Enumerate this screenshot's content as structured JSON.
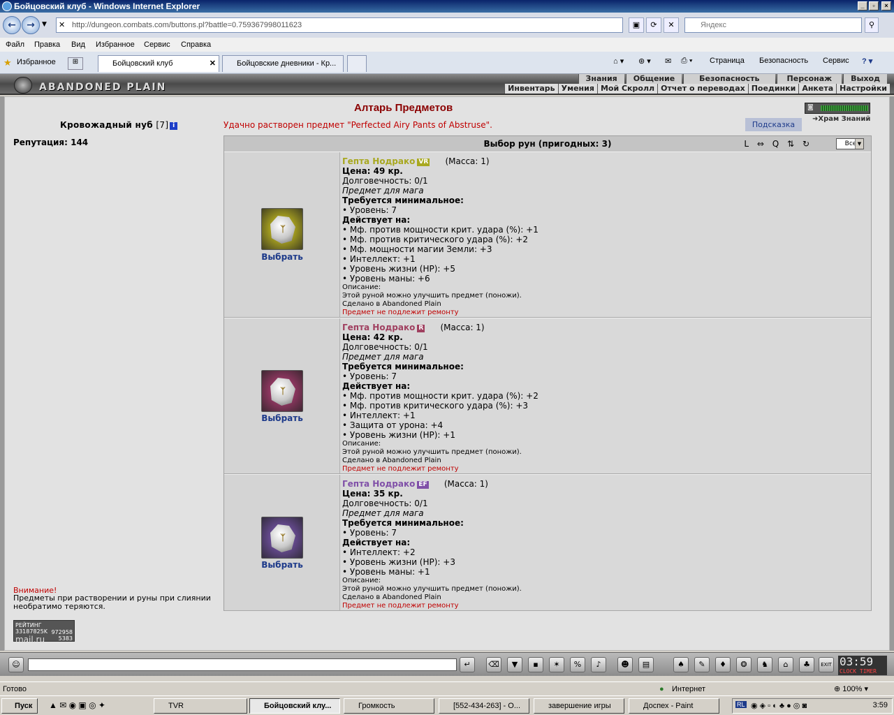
{
  "window": {
    "title": "Бойцовский клуб - Windows Internet Explorer"
  },
  "browser": {
    "url": "http://dungeon.combats.com/buttons.pl?battle=0.759367998011623",
    "search_placeholder": "Яндекс",
    "menu": [
      "Файл",
      "Правка",
      "Вид",
      "Избранное",
      "Сервис",
      "Справка"
    ],
    "favorites_label": "Избранное",
    "tabs": [
      "Бойцовский клуб",
      "Бойцовские дневники - Кр..."
    ],
    "commands": [
      "Страница",
      "Безопасность",
      "Сервис"
    ],
    "status_text": "Готово",
    "zone": "Интернет",
    "zoom": "100%"
  },
  "game": {
    "logo": "ABANDONED PLAIN",
    "top_links": [
      "Знания",
      "Общение",
      "Безопасность",
      "Персонаж",
      "Выход"
    ],
    "sub_links": [
      "Инвентарь",
      "Умения",
      "Мой Скролл",
      "Отчет о переводах",
      "Поединки",
      "Анкета",
      "Настройки"
    ],
    "character": {
      "name": "Кровожадный нуб",
      "level": "[7]",
      "info_icon": "i"
    },
    "reputation_label": "Репутация:",
    "reputation_value": "144",
    "altar_title": "Алтарь Предметов",
    "success_msg": "Удачно растворен предмет \"Perfected Airy Pants of Abstruse\".",
    "hint_button": "Подсказка",
    "temple_link": "Храм Знаний",
    "panel_title": "Выбор рун (пригодных: 3)",
    "sort_tools": [
      "L",
      "⇔",
      "Q",
      "⇅",
      "↻"
    ],
    "filter_value": "Все",
    "warning_title": "Внимание!",
    "warning_text": "Предметы при растворении и руны при слиянии необратимо теряются.",
    "mailru": {
      "label": "РЕЙТИНГ",
      "id": "33187825K",
      "brand": "mail.ru",
      "n1": "972958",
      "n2": "5383"
    }
  },
  "runes": [
    {
      "name": "Гепта Нодрако",
      "badge": "VR",
      "badge_color": "#a8a820",
      "name_color": "#a8a820",
      "img_color": "#b8b020",
      "mass": "(Масса: 1)",
      "price": "Цена: 49 кр.",
      "durability": "Долговечность: 0/1",
      "for_class": "Предмет для мага",
      "req_title": "Требуется минимальное:",
      "reqs": [
        "• Уровень: 7"
      ],
      "acts_title": "Действует на:",
      "effects": [
        "• Мф. против мощности крит. удара (%): +1",
        "• Мф. против критического удара (%): +2",
        "• Мф. мощности магии Земли: +3",
        "• Интеллект: +1",
        "• Уровень жизни (HP): +5",
        "• Уровень маны: +6"
      ],
      "desc_title": "Описание:",
      "desc": "Этой руной можно улучшить предмет (поножи).",
      "made_in": "Сделано в Abandoned Plain",
      "no_repair": "Предмет не подлежит ремонту",
      "choose": "Выбрать"
    },
    {
      "name": "Гепта Нодрако",
      "badge": "R",
      "badge_color": "#a04060",
      "name_color": "#a04060",
      "img_color": "#a03a6a",
      "mass": "(Масса: 1)",
      "price": "Цена: 42 кр.",
      "durability": "Долговечность: 0/1",
      "for_class": "Предмет для мага",
      "req_title": "Требуется минимальное:",
      "reqs": [
        "• Уровень: 7"
      ],
      "acts_title": "Действует на:",
      "effects": [
        "• Мф. против мощности крит. удара (%): +2",
        "• Мф. против критического удара (%): +3",
        "• Интеллект: +1",
        "• Защита от урона: +4",
        "• Уровень жизни (HP): +1"
      ],
      "desc_title": "Описание:",
      "desc": "Этой руной можно улучшить предмет (поножи).",
      "made_in": "Сделано в Abandoned Plain",
      "no_repair": "Предмет не подлежит ремонту",
      "choose": "Выбрать"
    },
    {
      "name": "Гепта Нодрако",
      "badge": "EF",
      "badge_color": "#8050a8",
      "name_color": "#8050a8",
      "img_color": "#7050a0",
      "mass": "(Масса: 1)",
      "price": "Цена: 35 кр.",
      "durability": "Долговечность: 0/1",
      "for_class": "Предмет для мага",
      "req_title": "Требуется минимальное:",
      "reqs": [
        "• Уровень: 7"
      ],
      "acts_title": "Действует на:",
      "effects": [
        "• Интеллект: +2",
        "• Уровень жизни (HP): +3",
        "• Уровень маны: +1"
      ],
      "desc_title": "Описание:",
      "desc": "Этой руной можно улучшить предмет (поножи).",
      "made_in": "Сделано в Abandoned Plain",
      "no_repair": "Предмет не подлежит ремонту",
      "choose": "Выбрать"
    }
  ],
  "clock": {
    "time": "03:59",
    "labels": "CLOCK TIMER"
  },
  "taskbar": {
    "start": "Пуск",
    "items": [
      "TVR",
      "Бойцовский клу...",
      "Громкость",
      "[552-434-263] - О...",
      "завершение игры",
      "Доспех - Paint"
    ],
    "time": "3:59",
    "lang": "RL"
  }
}
